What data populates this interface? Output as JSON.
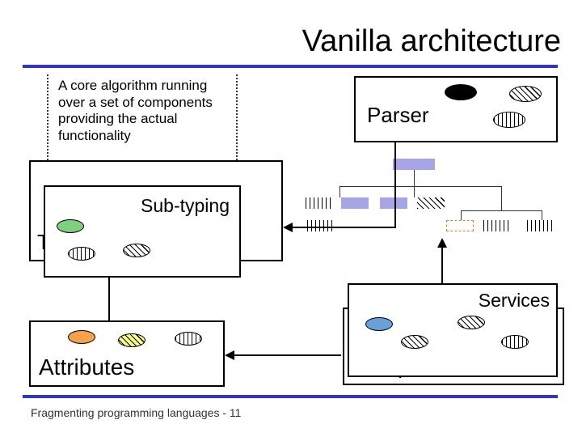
{
  "title": "Vanilla architecture",
  "description": "A core algorithm running over a set of components providing the actual functionality",
  "boxes": {
    "parser": "Parser",
    "subtyping": "Sub-typing",
    "typechecker": "Type checker",
    "services": "Services",
    "interpreter": "Interpreter",
    "attributes": "Attributes"
  },
  "footer": "Fragmenting programming languages  -  11"
}
